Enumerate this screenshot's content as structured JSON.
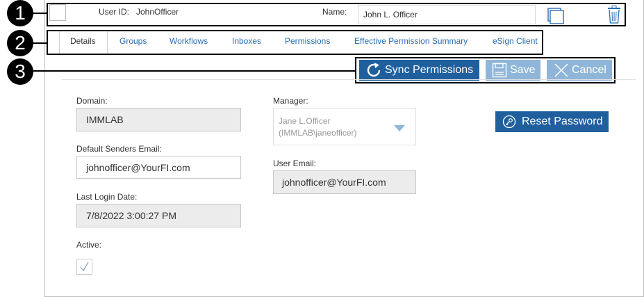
{
  "callouts": [
    "1",
    "2",
    "3"
  ],
  "header": {
    "user_id_label": "User ID:",
    "user_id_value": "JohnOfficer",
    "name_label": "Name:",
    "name_value": "John L. Officer"
  },
  "tabs": [
    {
      "label": "Details",
      "active": true
    },
    {
      "label": "Groups"
    },
    {
      "label": "Workflows"
    },
    {
      "label": "Inboxes"
    },
    {
      "label": "Permissions"
    },
    {
      "label": "Effective Permission Summary"
    },
    {
      "label": "eSign Client"
    }
  ],
  "actions": {
    "sync_label": "Sync Permissions",
    "save_label": "Save",
    "cancel_label": "Cancel"
  },
  "form": {
    "domain_label": "Domain:",
    "domain_value": "IMMLAB",
    "senders_email_label": "Default Senders Email:",
    "senders_email_value": "johnofficer@YourFI.com",
    "last_login_label": "Last Login Date:",
    "last_login_value": "7/8/2022 3:00:27 PM",
    "active_label": "Active:",
    "manager_label": "Manager:",
    "manager_value_line1": "Jane L.Officer",
    "manager_value_line2": "(IMMLAB\\janeofficer)",
    "user_email_label": "User Email:",
    "user_email_value": "johnofficer@YourFI.com",
    "reset_password_label": "Reset Password"
  },
  "colors": {
    "primary": "#1f5f9e",
    "disabled": "#8fb6d8",
    "link": "#2a6db0"
  },
  "icons": [
    "sync-icon",
    "save-icon",
    "cancel-icon",
    "key-icon",
    "copy-icon",
    "trash-icon",
    "chevron-down-icon",
    "checkmark-icon"
  ]
}
